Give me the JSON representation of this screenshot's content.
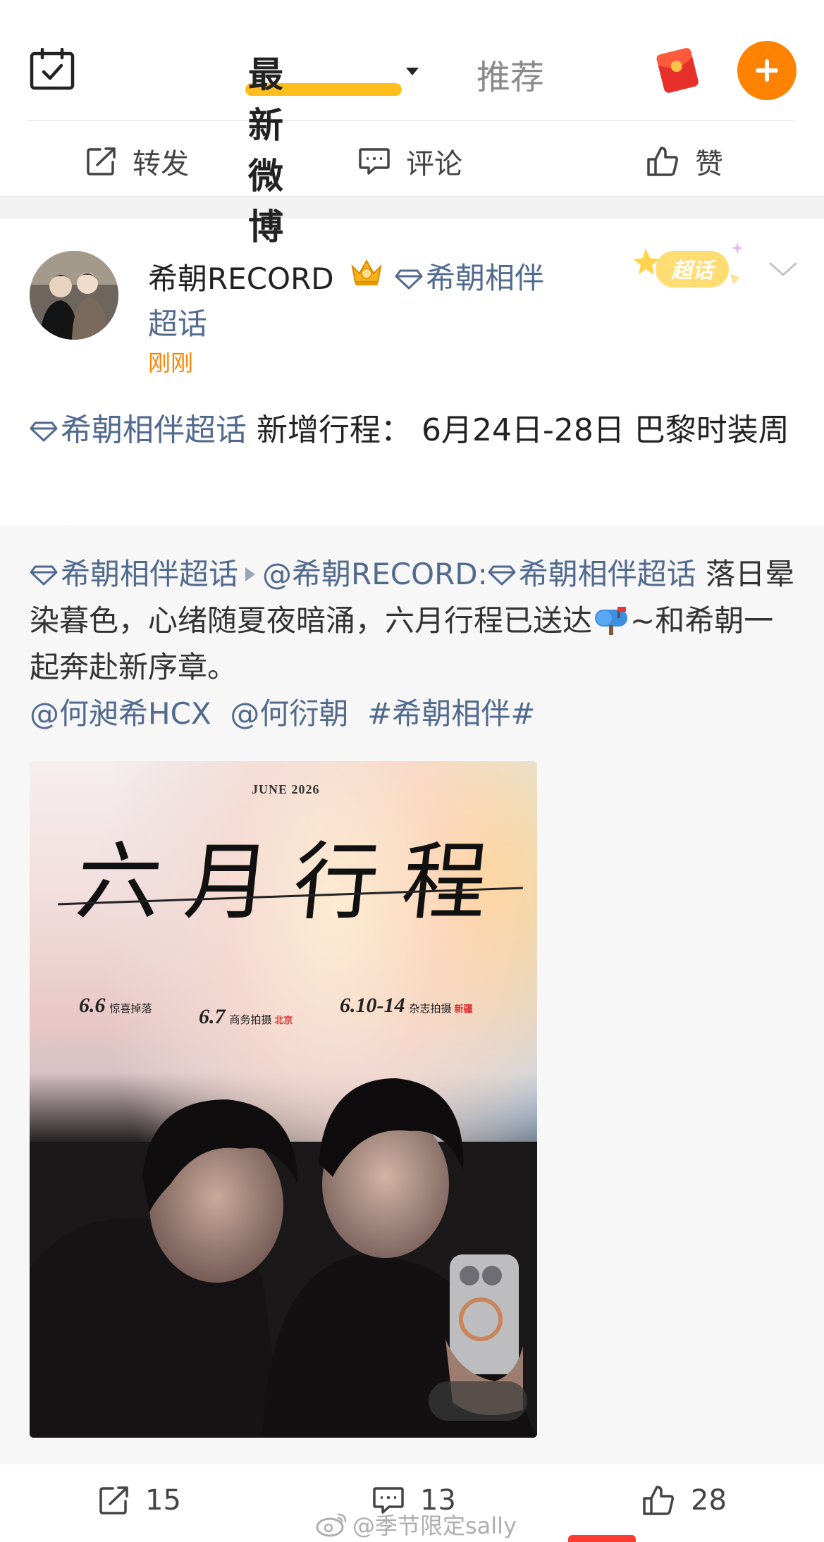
{
  "header": {
    "tab_latest": "最新微博",
    "tab_recommend": "推荐",
    "icons": [
      "calendar-check-icon",
      "red-packet-icon",
      "plus-icon"
    ],
    "accent": "#ff8200",
    "underline_color": "#ffbe1b"
  },
  "top_actions": {
    "repost": "转发",
    "comment": "评论",
    "like": "赞"
  },
  "post": {
    "username": "希朝RECORD",
    "supertopic_line1": "希朝相伴",
    "supertopic_line2": "超话",
    "time": "刚刚",
    "badge": "超话",
    "text_topic": "希朝相伴超话",
    "text_body": " 新增行程： 6月24日-28日 巴黎时装周"
  },
  "retweet": {
    "topic1": "希朝相伴超话",
    "mention_record": "@希朝RECORD:",
    "topic2": "希朝相伴超话",
    "body1": " 落日晕染暮色，心绪随夏夜暗涌，六月行程已送达",
    "body2": "~和希朝一起奔赴新序章。",
    "mention1": "@何昶希HCX",
    "mention2": "@何衍朝",
    "hashtag": "#希朝相伴#"
  },
  "poster": {
    "month": "JUNE 2026",
    "title": "六月行程",
    "items": [
      {
        "date": "6.6",
        "desc": "惊喜掉落",
        "loc": ""
      },
      {
        "date": "6.7",
        "desc": "商务拍摄",
        "loc": "北京"
      },
      {
        "date": "6.10-14",
        "desc": "杂志拍摄",
        "loc": "新疆"
      }
    ]
  },
  "bottom_actions": {
    "repost_count": "15",
    "comment_count": "13",
    "like_count": "28"
  },
  "watermark": "@季节限定sally"
}
